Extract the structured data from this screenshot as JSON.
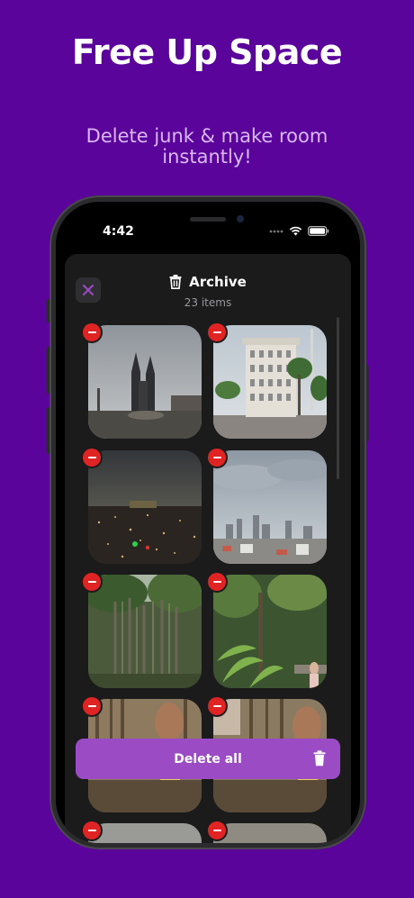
{
  "promo": {
    "headline": "Free Up Space",
    "subline": "Delete junk & make room instantly!"
  },
  "status_bar": {
    "time": "4:42"
  },
  "sheet": {
    "title": "Archive",
    "subtitle": "23 items",
    "delete_all_label": "Delete all"
  },
  "photos": [
    {
      "subject": "cathedral towers at dusk"
    },
    {
      "subject": "white tall building with palm trees"
    },
    {
      "subject": "city at night with lights"
    },
    {
      "subject": "city skyline on cloudy day"
    },
    {
      "subject": "banyan tree forest"
    },
    {
      "subject": "jungle with ferns and person"
    },
    {
      "subject": "shirtless man in park"
    },
    {
      "subject": "shirtless man in park"
    }
  ],
  "colors": {
    "background": "#5b049c",
    "accent_button": "#9b4cc4",
    "remove_badge": "#e02424",
    "close_icon": "#9b4cc4"
  },
  "icons": [
    "close-icon",
    "trash-icon",
    "wifi-icon",
    "battery-icon",
    "signal-dots-icon",
    "minus-icon"
  ]
}
